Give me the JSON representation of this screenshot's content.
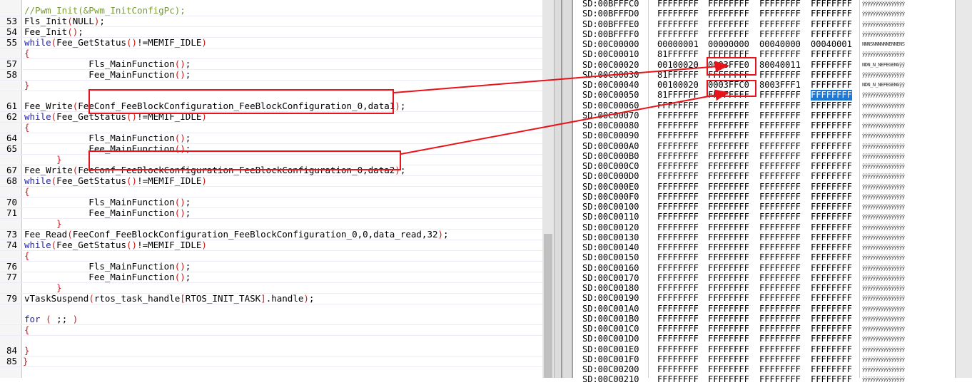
{
  "editor": {
    "lines": [
      {
        "num": "",
        "html_parts": [
          {
            "t": "//Pwm_Init(&Pwm_InitConfigPc);",
            "c": "cm"
          }
        ],
        "indent": "    "
      },
      {
        "num": "53",
        "parts": [
          {
            "t": "Fls_Init",
            "c": ""
          },
          {
            "t": "(",
            "c": "pn"
          },
          {
            "t": "NULL",
            "c": ""
          },
          {
            "t": ")",
            "c": "pn"
          },
          {
            "t": ";",
            "c": ""
          }
        ]
      },
      {
        "num": "54",
        "parts": [
          {
            "t": "Fee_Init",
            "c": ""
          },
          {
            "t": "()",
            "c": "pn"
          },
          {
            "t": ";",
            "c": ""
          }
        ]
      },
      {
        "num": "55",
        "parts": [
          {
            "t": "while",
            "c": "kw"
          },
          {
            "t": "(",
            "c": "pn"
          },
          {
            "t": "Fee_GetStatus",
            "c": ""
          },
          {
            "t": "()",
            "c": "pn"
          },
          {
            "t": "!=MEMIF_IDLE",
            "c": ""
          },
          {
            "t": ")",
            "c": "pn"
          }
        ]
      },
      {
        "num": "",
        "parts": [
          {
            "t": "{",
            "c": "pn"
          }
        ]
      },
      {
        "num": "57",
        "parts": [
          {
            "t": "            Fls_MainFunction",
            "c": ""
          },
          {
            "t": "()",
            "c": "pn"
          },
          {
            "t": ";",
            "c": ""
          }
        ]
      },
      {
        "num": "58",
        "parts": [
          {
            "t": "            Fee_MainFunction",
            "c": ""
          },
          {
            "t": "()",
            "c": "pn"
          },
          {
            "t": ";",
            "c": ""
          }
        ]
      },
      {
        "num": "",
        "parts": [
          {
            "t": "}",
            "c": "pn"
          }
        ]
      },
      {
        "num": "",
        "parts": []
      },
      {
        "num": "61",
        "parts": [
          {
            "t": "Fee_Write",
            "c": ""
          },
          {
            "t": "(",
            "c": "pn"
          },
          {
            "t": "FeeConf_FeeBlockConfiguration_FeeBlockConfiguration_0,data1",
            "c": ""
          },
          {
            "t": ")",
            "c": "pn"
          },
          {
            "t": ";",
            "c": ""
          }
        ]
      },
      {
        "num": "62",
        "parts": [
          {
            "t": "while",
            "c": "kw"
          },
          {
            "t": "(",
            "c": "pn"
          },
          {
            "t": "Fee_GetStatus",
            "c": ""
          },
          {
            "t": "()",
            "c": "pn"
          },
          {
            "t": "!=MEMIF_IDLE",
            "c": ""
          },
          {
            "t": ")",
            "c": "pn"
          }
        ]
      },
      {
        "num": "",
        "parts": [
          {
            "t": "{",
            "c": "pn"
          }
        ]
      },
      {
        "num": "64",
        "parts": [
          {
            "t": "            Fls_MainFunction",
            "c": ""
          },
          {
            "t": "()",
            "c": "pn"
          },
          {
            "t": ";",
            "c": ""
          }
        ]
      },
      {
        "num": "65",
        "parts": [
          {
            "t": "            Fee_MainFunction",
            "c": ""
          },
          {
            "t": "()",
            "c": "pn"
          },
          {
            "t": ";",
            "c": ""
          }
        ]
      },
      {
        "num": "",
        "parts": [
          {
            "t": "      }",
            "c": "pn"
          }
        ]
      },
      {
        "num": "67",
        "parts": [
          {
            "t": "Fee_Write",
            "c": ""
          },
          {
            "t": "(",
            "c": "pn"
          },
          {
            "t": "FeeConf_FeeBlockConfiguration_FeeBlockConfiguration_0,data2",
            "c": ""
          },
          {
            "t": ")",
            "c": "pn"
          },
          {
            "t": ";",
            "c": ""
          }
        ]
      },
      {
        "num": "68",
        "parts": [
          {
            "t": "while",
            "c": "kw"
          },
          {
            "t": "(",
            "c": "pn"
          },
          {
            "t": "Fee_GetStatus",
            "c": ""
          },
          {
            "t": "()",
            "c": "pn"
          },
          {
            "t": "!=MEMIF_IDLE",
            "c": ""
          },
          {
            "t": ")",
            "c": "pn"
          }
        ]
      },
      {
        "num": "",
        "parts": [
          {
            "t": "{",
            "c": "pn"
          }
        ]
      },
      {
        "num": "70",
        "parts": [
          {
            "t": "            Fls_MainFunction",
            "c": ""
          },
          {
            "t": "()",
            "c": "pn"
          },
          {
            "t": ";",
            "c": ""
          }
        ]
      },
      {
        "num": "71",
        "parts": [
          {
            "t": "            Fee_MainFunction",
            "c": ""
          },
          {
            "t": "()",
            "c": "pn"
          },
          {
            "t": ";",
            "c": ""
          }
        ]
      },
      {
        "num": "",
        "parts": [
          {
            "t": "      }",
            "c": "pn"
          }
        ]
      },
      {
        "num": "73",
        "parts": [
          {
            "t": "Fee_Read",
            "c": ""
          },
          {
            "t": "(",
            "c": "pn"
          },
          {
            "t": "FeeConf_FeeBlockConfiguration_FeeBlockConfiguration_0,0,data_read,32",
            "c": ""
          },
          {
            "t": ")",
            "c": "pn"
          },
          {
            "t": ";",
            "c": ""
          }
        ]
      },
      {
        "num": "74",
        "parts": [
          {
            "t": "while",
            "c": "kw"
          },
          {
            "t": "(",
            "c": "pn"
          },
          {
            "t": "Fee_GetStatus",
            "c": ""
          },
          {
            "t": "()",
            "c": "pn"
          },
          {
            "t": "!=MEMIF_IDLE",
            "c": ""
          },
          {
            "t": ")",
            "c": "pn"
          }
        ]
      },
      {
        "num": "",
        "parts": [
          {
            "t": "{",
            "c": "pn"
          }
        ]
      },
      {
        "num": "76",
        "parts": [
          {
            "t": "            Fls_MainFunction",
            "c": ""
          },
          {
            "t": "()",
            "c": "pn"
          },
          {
            "t": ";",
            "c": ""
          }
        ]
      },
      {
        "num": "77",
        "parts": [
          {
            "t": "            Fee_MainFunction",
            "c": ""
          },
          {
            "t": "()",
            "c": "pn"
          },
          {
            "t": ";",
            "c": ""
          }
        ]
      },
      {
        "num": "",
        "parts": [
          {
            "t": "      }",
            "c": "pn"
          }
        ]
      },
      {
        "num": "79",
        "parts": [
          {
            "t": "vTaskSuspend",
            "c": ""
          },
          {
            "t": "(",
            "c": "pn"
          },
          {
            "t": "rtos_task_handle",
            "c": ""
          },
          {
            "t": "[",
            "c": "pn"
          },
          {
            "t": "RTOS_INIT_TASK",
            "c": ""
          },
          {
            "t": "]",
            "c": "pn"
          },
          {
            "t": ".handle",
            "c": ""
          },
          {
            "t": ")",
            "c": "pn"
          },
          {
            "t": ";",
            "c": ""
          }
        ]
      },
      {
        "num": "",
        "parts": []
      },
      {
        "num": "",
        "parts": [
          {
            "t": "for",
            "c": "kw"
          },
          {
            "t": " ",
            "c": ""
          },
          {
            "t": "(",
            "c": "pn"
          },
          {
            "t": " ;; ",
            "c": ""
          },
          {
            "t": ")",
            "c": "pn"
          }
        ]
      },
      {
        "num": "",
        "parts": [
          {
            "t": "{",
            "c": "pn"
          }
        ]
      },
      {
        "num": "",
        "parts": []
      },
      {
        "num": "84",
        "parts": [
          {
            "t": "}",
            "c": "pn"
          }
        ]
      },
      {
        "num": "85",
        "parts": [
          {
            "t": "}",
            "c": "pn"
          }
        ],
        "outdent": true
      }
    ]
  },
  "memory": {
    "rows": [
      {
        "addr": "SD:00BFFFC0",
        "w": [
          "FFFFFFFF",
          "FFFFFFFF",
          "FFFFFFFF",
          "FFFFFFFF"
        ],
        "asc": "ÿÿÿÿÿÿÿÿÿÿÿÿÿÿÿÿ"
      },
      {
        "addr": "SD:00BFFFD0",
        "w": [
          "FFFFFFFF",
          "FFFFFFFF",
          "FFFFFFFF",
          "FFFFFFFF"
        ],
        "asc": "ÿÿÿÿÿÿÿÿÿÿÿÿÿÿÿÿ"
      },
      {
        "addr": "SD:00BFFFE0",
        "w": [
          "FFFFFFFF",
          "FFFFFFFF",
          "FFFFFFFF",
          "FFFFFFFF"
        ],
        "asc": "ÿÿÿÿÿÿÿÿÿÿÿÿÿÿÿÿ"
      },
      {
        "addr": "SD:00BFFFF0",
        "w": [
          "FFFFFFFF",
          "FFFFFFFF",
          "FFFFFFFF",
          "FFFFFFFF"
        ],
        "asc": "ÿÿÿÿÿÿÿÿÿÿÿÿÿÿÿÿ"
      },
      {
        "addr": "SD:00C00000",
        "w": [
          "00000001",
          "00000000",
          "00040000",
          "00040001"
        ],
        "asc": "NNNSNNNNNNENNENS"
      },
      {
        "addr": "SD:00C00010",
        "w": [
          "81FFFFFF",
          "FFFFFFFF",
          "FFFFFFFF",
          "FFFFFFFF"
        ],
        "asc": "ÿÿÿÿÿÿÿÿÿÿÿÿÿÿÿÿ"
      },
      {
        "addr": "SD:00C00020",
        "w": [
          "00100020",
          "0003FFE0",
          "80040011",
          "FFFFFFFF"
        ],
        "asc": "NDN_N_NEFEGENGÿÿ"
      },
      {
        "addr": "SD:00C00030",
        "w": [
          "81FFFFFF",
          "FFFFFFFF",
          "FFFFFFFF",
          "FFFFFFFF"
        ],
        "asc": "ÿÿÿÿÿÿÿÿÿÿÿÿÿÿÿÿ"
      },
      {
        "addr": "SD:00C00040",
        "w": [
          "00100020",
          "0003FFC0",
          "8003FFF1",
          "FFFFFFFF"
        ],
        "asc": "NDN_N_NEFEGENGÿÿ"
      },
      {
        "addr": "SD:00C00050",
        "w": [
          "81FFFFFF",
          "FFFFFFFF",
          "FFFFFFFF",
          "FFFFFFFF"
        ],
        "asc": "ÿÿÿÿÿÿÿÿÿÿÿÿÿÿÿÿ"
      },
      {
        "addr": "SD:00C00060",
        "w": [
          "FFFFFFFF",
          "FFFFFFFF",
          "FFFFFFFF",
          "FFFFFFFF"
        ],
        "asc": "ÿÿÿÿÿÿÿÿÿÿÿÿÿÿÿÿ"
      },
      {
        "addr": "SD:00C00070",
        "w": [
          "FFFFFFFF",
          "FFFFFFFF",
          "FFFFFFFF",
          "FFFFFFFF"
        ],
        "asc": "ÿÿÿÿÿÿÿÿÿÿÿÿÿÿÿÿ"
      },
      {
        "addr": "SD:00C00080",
        "w": [
          "FFFFFFFF",
          "FFFFFFFF",
          "FFFFFFFF",
          "FFFFFFFF"
        ],
        "asc": "ÿÿÿÿÿÿÿÿÿÿÿÿÿÿÿÿ"
      },
      {
        "addr": "SD:00C00090",
        "w": [
          "FFFFFFFF",
          "FFFFFFFF",
          "FFFFFFFF",
          "FFFFFFFF"
        ],
        "asc": "ÿÿÿÿÿÿÿÿÿÿÿÿÿÿÿÿ"
      },
      {
        "addr": "SD:00C000A0",
        "w": [
          "FFFFFFFF",
          "FFFFFFFF",
          "FFFFFFFF",
          "FFFFFFFF"
        ],
        "asc": "ÿÿÿÿÿÿÿÿÿÿÿÿÿÿÿÿ"
      },
      {
        "addr": "SD:00C000B0",
        "w": [
          "FFFFFFFF",
          "FFFFFFFF",
          "FFFFFFFF",
          "FFFFFFFF"
        ],
        "asc": "ÿÿÿÿÿÿÿÿÿÿÿÿÿÿÿÿ"
      },
      {
        "addr": "SD:00C000C0",
        "w": [
          "FFFFFFFF",
          "FFFFFFFF",
          "FFFFFFFF",
          "FFFFFFFF"
        ],
        "asc": "ÿÿÿÿÿÿÿÿÿÿÿÿÿÿÿÿ"
      },
      {
        "addr": "SD:00C000D0",
        "w": [
          "FFFFFFFF",
          "FFFFFFFF",
          "FFFFFFFF",
          "FFFFFFFF"
        ],
        "asc": "ÿÿÿÿÿÿÿÿÿÿÿÿÿÿÿÿ"
      },
      {
        "addr": "SD:00C000E0",
        "w": [
          "FFFFFFFF",
          "FFFFFFFF",
          "FFFFFFFF",
          "FFFFFFFF"
        ],
        "asc": "ÿÿÿÿÿÿÿÿÿÿÿÿÿÿÿÿ"
      },
      {
        "addr": "SD:00C000F0",
        "w": [
          "FFFFFFFF",
          "FFFFFFFF",
          "FFFFFFFF",
          "FFFFFFFF"
        ],
        "asc": "ÿÿÿÿÿÿÿÿÿÿÿÿÿÿÿÿ"
      },
      {
        "addr": "SD:00C00100",
        "w": [
          "FFFFFFFF",
          "FFFFFFFF",
          "FFFFFFFF",
          "FFFFFFFF"
        ],
        "asc": "ÿÿÿÿÿÿÿÿÿÿÿÿÿÿÿÿ"
      },
      {
        "addr": "SD:00C00110",
        "w": [
          "FFFFFFFF",
          "FFFFFFFF",
          "FFFFFFFF",
          "FFFFFFFF"
        ],
        "asc": "ÿÿÿÿÿÿÿÿÿÿÿÿÿÿÿÿ"
      },
      {
        "addr": "SD:00C00120",
        "w": [
          "FFFFFFFF",
          "FFFFFFFF",
          "FFFFFFFF",
          "FFFFFFFF"
        ],
        "asc": "ÿÿÿÿÿÿÿÿÿÿÿÿÿÿÿÿ"
      },
      {
        "addr": "SD:00C00130",
        "w": [
          "FFFFFFFF",
          "FFFFFFFF",
          "FFFFFFFF",
          "FFFFFFFF"
        ],
        "asc": "ÿÿÿÿÿÿÿÿÿÿÿÿÿÿÿÿ"
      },
      {
        "addr": "SD:00C00140",
        "w": [
          "FFFFFFFF",
          "FFFFFFFF",
          "FFFFFFFF",
          "FFFFFFFF"
        ],
        "asc": "ÿÿÿÿÿÿÿÿÿÿÿÿÿÿÿÿ"
      },
      {
        "addr": "SD:00C00150",
        "w": [
          "FFFFFFFF",
          "FFFFFFFF",
          "FFFFFFFF",
          "FFFFFFFF"
        ],
        "asc": "ÿÿÿÿÿÿÿÿÿÿÿÿÿÿÿÿ"
      },
      {
        "addr": "SD:00C00160",
        "w": [
          "FFFFFFFF",
          "FFFFFFFF",
          "FFFFFFFF",
          "FFFFFFFF"
        ],
        "asc": "ÿÿÿÿÿÿÿÿÿÿÿÿÿÿÿÿ"
      },
      {
        "addr": "SD:00C00170",
        "w": [
          "FFFFFFFF",
          "FFFFFFFF",
          "FFFFFFFF",
          "FFFFFFFF"
        ],
        "asc": "ÿÿÿÿÿÿÿÿÿÿÿÿÿÿÿÿ"
      },
      {
        "addr": "SD:00C00180",
        "w": [
          "FFFFFFFF",
          "FFFFFFFF",
          "FFFFFFFF",
          "FFFFFFFF"
        ],
        "asc": "ÿÿÿÿÿÿÿÿÿÿÿÿÿÿÿÿ"
      },
      {
        "addr": "SD:00C00190",
        "w": [
          "FFFFFFFF",
          "FFFFFFFF",
          "FFFFFFFF",
          "FFFFFFFF"
        ],
        "asc": "ÿÿÿÿÿÿÿÿÿÿÿÿÿÿÿÿ"
      },
      {
        "addr": "SD:00C001A0",
        "w": [
          "FFFFFFFF",
          "FFFFFFFF",
          "FFFFFFFF",
          "FFFFFFFF"
        ],
        "asc": "ÿÿÿÿÿÿÿÿÿÿÿÿÿÿÿÿ"
      },
      {
        "addr": "SD:00C001B0",
        "w": [
          "FFFFFFFF",
          "FFFFFFFF",
          "FFFFFFFF",
          "FFFFFFFF"
        ],
        "asc": "ÿÿÿÿÿÿÿÿÿÿÿÿÿÿÿÿ"
      },
      {
        "addr": "SD:00C001C0",
        "w": [
          "FFFFFFFF",
          "FFFFFFFF",
          "FFFFFFFF",
          "FFFFFFFF"
        ],
        "asc": "ÿÿÿÿÿÿÿÿÿÿÿÿÿÿÿÿ"
      },
      {
        "addr": "SD:00C001D0",
        "w": [
          "FFFFFFFF",
          "FFFFFFFF",
          "FFFFFFFF",
          "FFFFFFFF"
        ],
        "asc": "ÿÿÿÿÿÿÿÿÿÿÿÿÿÿÿÿ"
      },
      {
        "addr": "SD:00C001E0",
        "w": [
          "FFFFFFFF",
          "FFFFFFFF",
          "FFFFFFFF",
          "FFFFFFFF"
        ],
        "asc": "ÿÿÿÿÿÿÿÿÿÿÿÿÿÿÿÿ"
      },
      {
        "addr": "SD:00C001F0",
        "w": [
          "FFFFFFFF",
          "FFFFFFFF",
          "FFFFFFFF",
          "FFFFFFFF"
        ],
        "asc": "ÿÿÿÿÿÿÿÿÿÿÿÿÿÿÿÿ"
      },
      {
        "addr": "SD:00C00200",
        "w": [
          "FFFFFFFF",
          "FFFFFFFF",
          "FFFFFFFF",
          "FFFFFFFF"
        ],
        "asc": "ÿÿÿÿÿÿÿÿÿÿÿÿÿÿÿÿ"
      },
      {
        "addr": "SD:00C00210",
        "w": [
          "FFFFFFFF",
          "FFFFFFFF",
          "FFFFFFFF",
          "FFFFFFFF"
        ],
        "asc": "ÿÿÿÿÿÿÿÿÿÿÿÿÿÿÿÿ"
      }
    ],
    "highlight": {
      "row": 9,
      "col": 3
    }
  },
  "colors": {
    "annotation": "#e8141b",
    "selection": "#1e78d6",
    "keyword": "#2020c8",
    "paren": "#d01818",
    "comment": "#7a9a3a"
  }
}
